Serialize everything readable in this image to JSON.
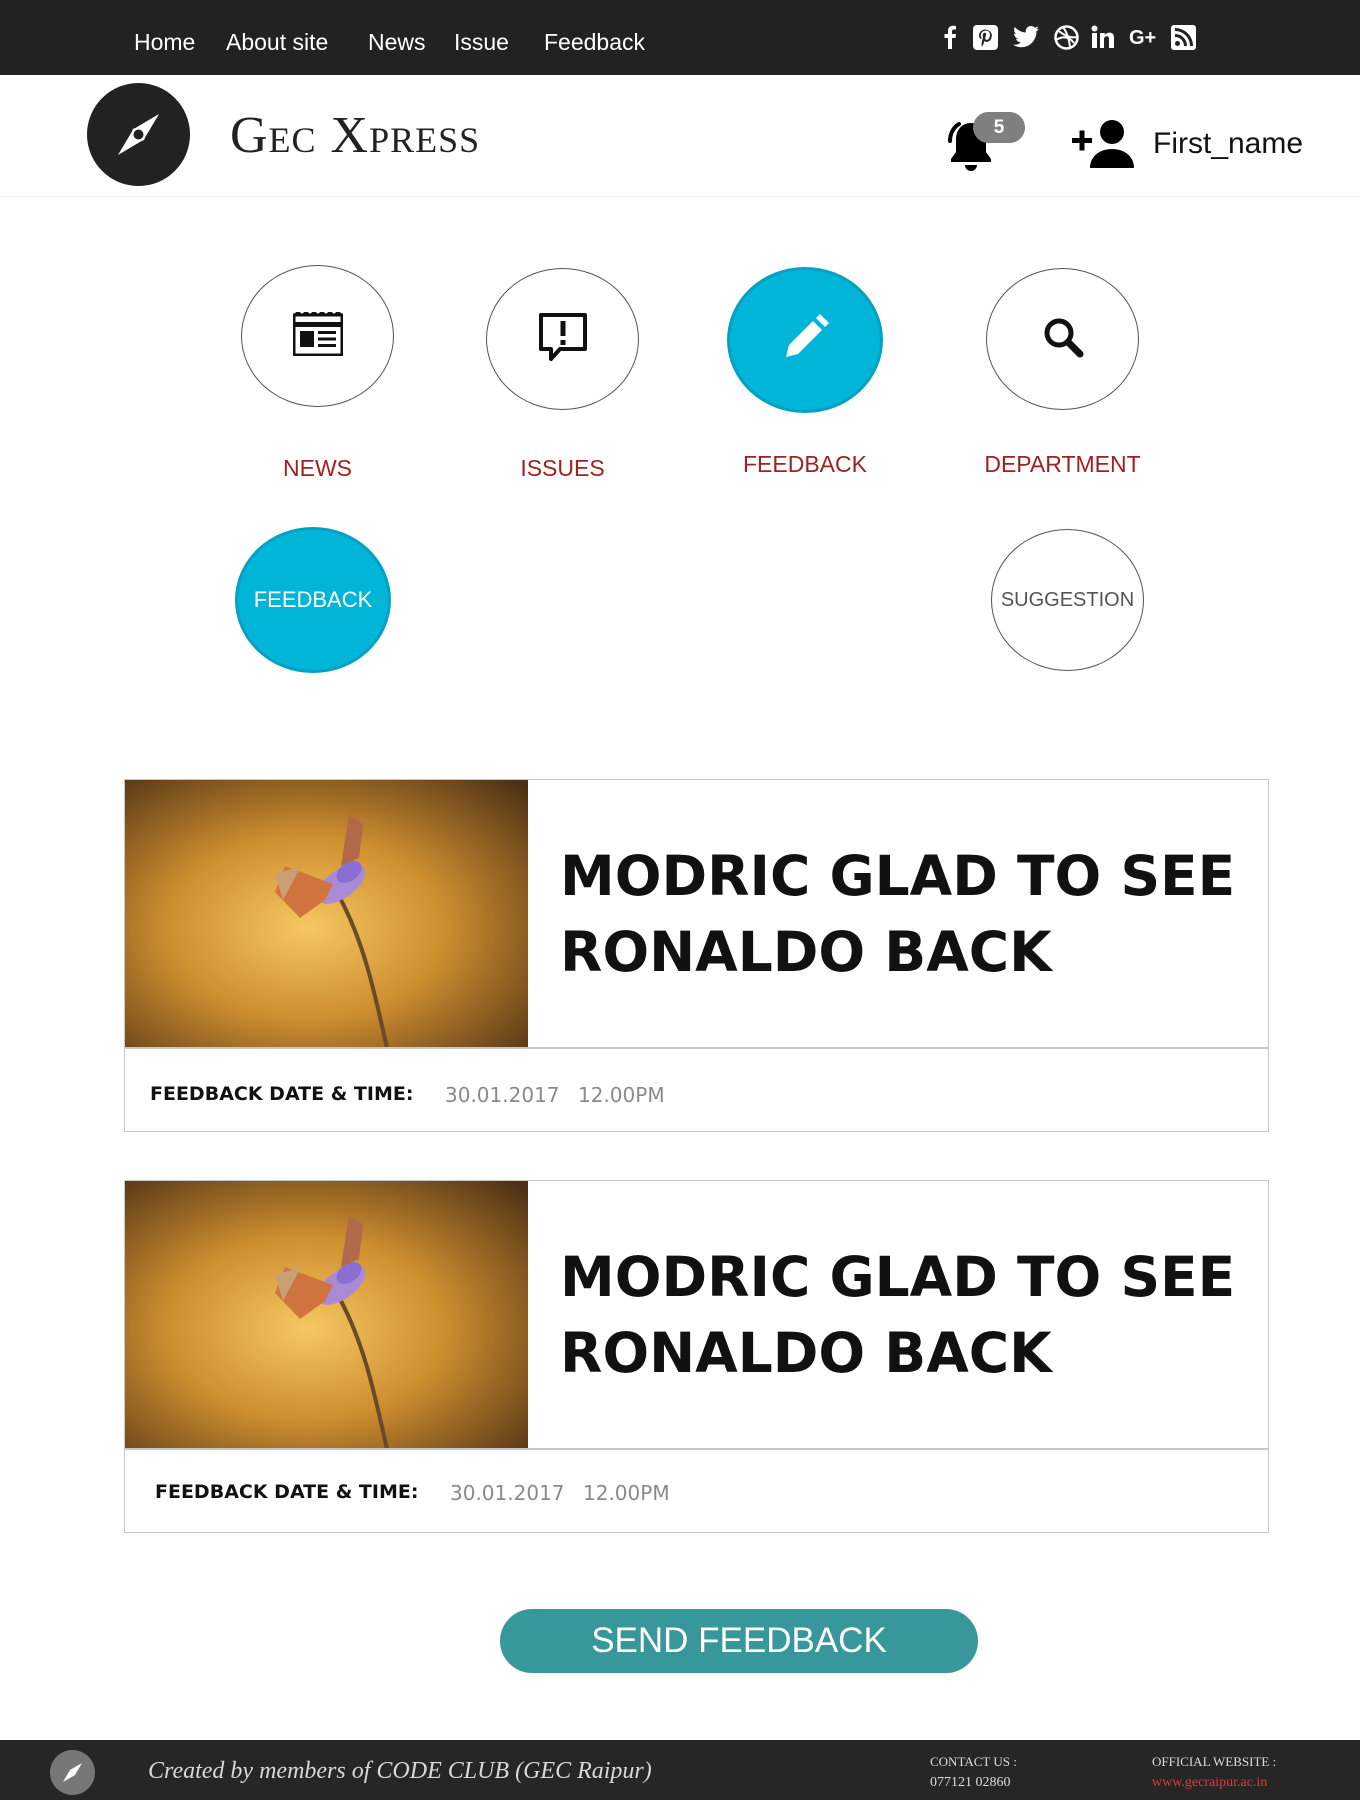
{
  "topnav": {
    "items": [
      "Home",
      "About site",
      "News",
      "Issue",
      "Feedback"
    ],
    "social_icons": [
      "facebook-icon",
      "pinterest-icon",
      "twitter-icon",
      "dribbble-icon",
      "linkedin-icon",
      "google-plus-icon",
      "rss-icon"
    ]
  },
  "header": {
    "brand": "Gec Xpress",
    "notification_count": "5",
    "username": "First_name",
    "icons": [
      "compass-logo-icon",
      "bell-icon",
      "add-user-icon"
    ]
  },
  "menu": {
    "items": [
      {
        "label": "NEWS",
        "icon": "newspaper-icon",
        "active": false
      },
      {
        "label": "ISSUES",
        "icon": "report-icon",
        "active": false
      },
      {
        "label": "FEEDBACK",
        "icon": "pencil-icon",
        "active": true
      },
      {
        "label": "DEPARTMENT",
        "icon": "search-icon",
        "active": false
      }
    ],
    "sub_items": [
      {
        "label": "FEEDBACK",
        "active": true
      },
      {
        "label": "SUGGESTION",
        "active": false
      }
    ],
    "accent_color": "#00b5d8",
    "label_color": "#a32020"
  },
  "feedbacks": [
    {
      "title": "MODRIC GLAD TO SEE RONALDO BACK",
      "meta_label": "FEEDBACK DATE & TIME:",
      "date": "30.01.2017",
      "time": "12.00PM",
      "image": "butterfly-on-flower-photo"
    },
    {
      "title": "MODRIC GLAD TO SEE RONALDO BACK",
      "meta_label": "FEEDBACK DATE & TIME:",
      "date": "30.01.2017",
      "time": "12.00PM",
      "image": "butterfly-on-flower-photo"
    }
  ],
  "send_button": {
    "label": "SEND FEEDBACK",
    "color": "#37979a"
  },
  "footer": {
    "credit": "Created by members of CODE CLUB (GEC Raipur)",
    "contact_label": "CONTACT US :",
    "contact_value": "077121 02860",
    "website_label": "OFFICIAL WEBSITE :",
    "website_value": "www.gecraipur.ac.in",
    "website_color": "#e53935"
  }
}
